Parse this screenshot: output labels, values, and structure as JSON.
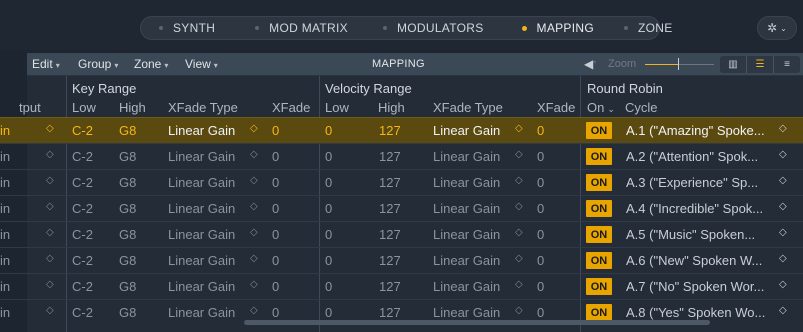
{
  "tabs": [
    {
      "label": "SYNTH",
      "active": false
    },
    {
      "label": "MOD MATRIX",
      "active": false
    },
    {
      "label": "MODULATORS",
      "active": false
    },
    {
      "label": "MAPPING",
      "active": true
    },
    {
      "label": "ZONE",
      "active": false
    }
  ],
  "settings_icon": "gear-icon",
  "toolbar": {
    "menus": [
      "Edit",
      "Group",
      "Zone",
      "View"
    ],
    "title": "MAPPING",
    "speaker_icon": "speaker-icon",
    "zoom_label": "Zoom",
    "view_icons": [
      "keyboard-view-icon",
      "list-view-icon",
      "hybrid-view-icon"
    ]
  },
  "groups": {
    "key_range": "Key Range",
    "velocity_range": "Velocity Range",
    "round_robin": "Round Robin"
  },
  "columns": {
    "output": "tput",
    "key_low": "Low",
    "key_high": "High",
    "key_xfade_type": "XFade Type",
    "key_xfade": "XFade",
    "vel_low": "Low",
    "vel_high": "High",
    "vel_xfade_type": "XFade Type",
    "vel_xfade": "XFade",
    "rr_on": "On",
    "rr_cycle": "Cycle"
  },
  "rows": [
    {
      "out": "in",
      "klow": "C-2",
      "khigh": "G8",
      "ktype": "Linear Gain",
      "kx": "0",
      "vlow": "0",
      "vhigh": "127",
      "vtype": "Linear Gain",
      "vx": "0",
      "on": "ON",
      "cycle": "A.1 (\"Amazing\" Spoke...",
      "selected": true
    },
    {
      "out": "in",
      "klow": "C-2",
      "khigh": "G8",
      "ktype": "Linear Gain",
      "kx": "0",
      "vlow": "0",
      "vhigh": "127",
      "vtype": "Linear Gain",
      "vx": "0",
      "on": "ON",
      "cycle": "A.2 (\"Attention\" Spok...",
      "selected": false
    },
    {
      "out": "in",
      "klow": "C-2",
      "khigh": "G8",
      "ktype": "Linear Gain",
      "kx": "0",
      "vlow": "0",
      "vhigh": "127",
      "vtype": "Linear Gain",
      "vx": "0",
      "on": "ON",
      "cycle": "A.3 (\"Experience\" Sp...",
      "selected": false
    },
    {
      "out": "in",
      "klow": "C-2",
      "khigh": "G8",
      "ktype": "Linear Gain",
      "kx": "0",
      "vlow": "0",
      "vhigh": "127",
      "vtype": "Linear Gain",
      "vx": "0",
      "on": "ON",
      "cycle": "A.4 (\"Incredible\" Spok...",
      "selected": false
    },
    {
      "out": "in",
      "klow": "C-2",
      "khigh": "G8",
      "ktype": "Linear Gain",
      "kx": "0",
      "vlow": "0",
      "vhigh": "127",
      "vtype": "Linear Gain",
      "vx": "0",
      "on": "ON",
      "cycle": "A.5 (\"Music\" Spoken...",
      "selected": false
    },
    {
      "out": "in",
      "klow": "C-2",
      "khigh": "G8",
      "ktype": "Linear Gain",
      "kx": "0",
      "vlow": "0",
      "vhigh": "127",
      "vtype": "Linear Gain",
      "vx": "0",
      "on": "ON",
      "cycle": "A.6 (\"New\" Spoken W...",
      "selected": false
    },
    {
      "out": "in",
      "klow": "C-2",
      "khigh": "G8",
      "ktype": "Linear Gain",
      "kx": "0",
      "vlow": "0",
      "vhigh": "127",
      "vtype": "Linear Gain",
      "vx": "0",
      "on": "ON",
      "cycle": "A.7 (\"No\" Spoken Wor...",
      "selected": false
    },
    {
      "out": "in",
      "klow": "C-2",
      "khigh": "G8",
      "ktype": "Linear Gain",
      "kx": "0",
      "vlow": "0",
      "vhigh": "127",
      "vtype": "Linear Gain",
      "vx": "0",
      "on": "ON",
      "cycle": "A.8 (\"Yes\" Spoken Wo...",
      "selected": false
    }
  ],
  "accent_color": "#f0b41a"
}
